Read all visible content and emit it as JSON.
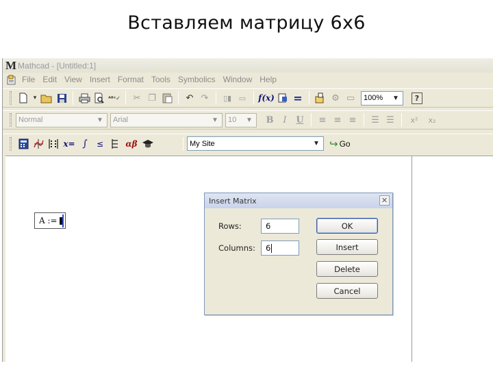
{
  "slide": {
    "title": "Вставляем матрицу 6х6"
  },
  "app": {
    "title": "Mathcad - [Untitled:1]",
    "logo_letter": "M",
    "menu": [
      "File",
      "Edit",
      "View",
      "Insert",
      "Format",
      "Tools",
      "Symbolics",
      "Window",
      "Help"
    ],
    "zoom_value": "100%",
    "style_value": "Normal",
    "font_value": "Arial",
    "size_value": "10",
    "resource_value": "My Site",
    "go_label": "Go",
    "format_buttons": {
      "bold": "B",
      "italic": "I",
      "underline": "U"
    },
    "script_buttons": {
      "superscript": "x²",
      "subscript": "x₂"
    },
    "function_label": "f(x)",
    "xequals_label": "x=",
    "greek_label": "αβ"
  },
  "worksheet": {
    "math_region_text": "A :="
  },
  "dialog": {
    "title": "Insert Matrix",
    "rows_label": "Rows:",
    "rows_value": "6",
    "columns_label": "Columns:",
    "columns_value": "6",
    "buttons": {
      "ok": "OK",
      "insert": "Insert",
      "delete": "Delete",
      "cancel": "Cancel"
    }
  }
}
